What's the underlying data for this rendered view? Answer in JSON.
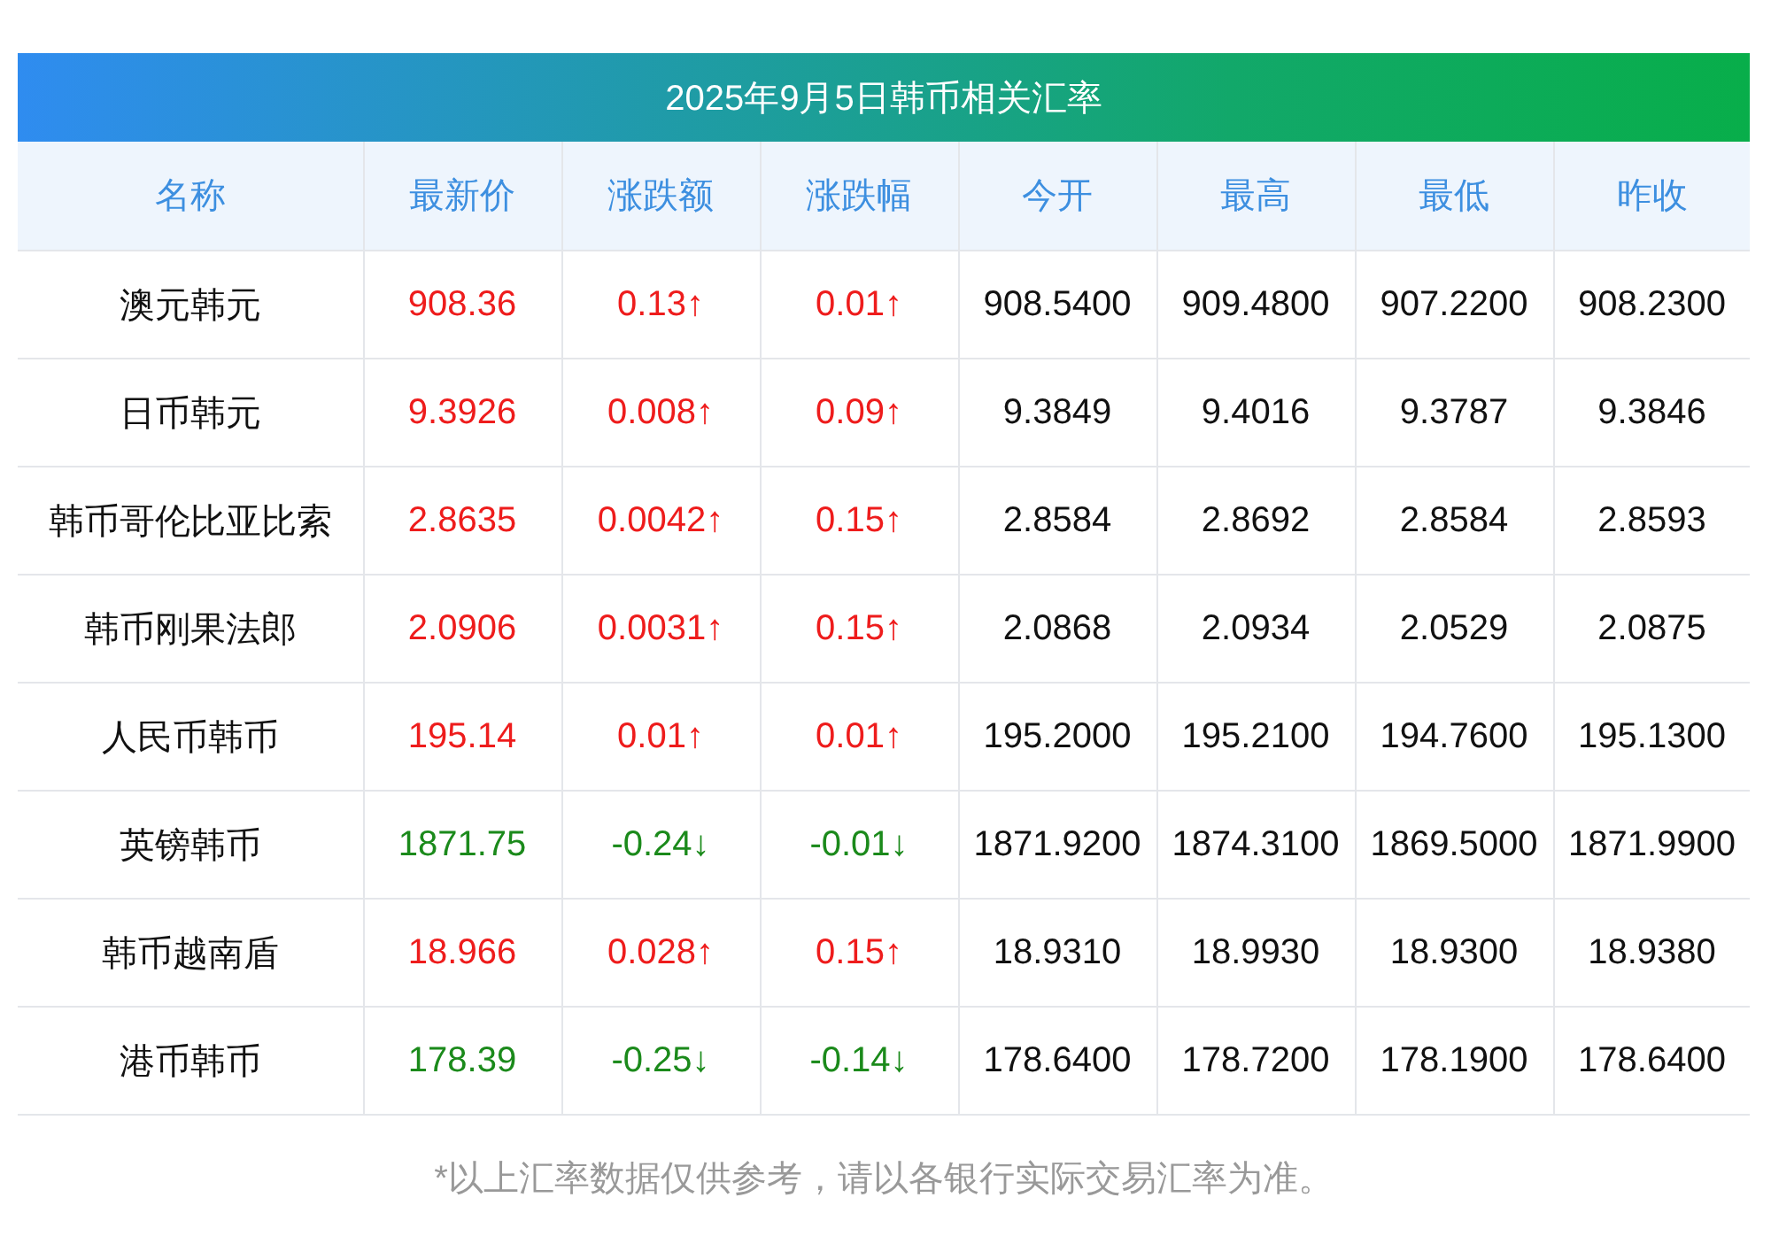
{
  "title": "2025年9月5日韩币相关汇率",
  "table": {
    "columns": [
      "名称",
      "最新价",
      "涨跌额",
      "涨跌幅",
      "今开",
      "最高",
      "最低",
      "昨收"
    ],
    "rows": [
      {
        "kind": "up",
        "cells": [
          "澳元韩元",
          "908.36",
          "0.13↑",
          "0.01↑",
          "908.5400",
          "909.4800",
          "907.2200",
          "908.2300"
        ]
      },
      {
        "kind": "up",
        "cells": [
          "日币韩元",
          "9.3926",
          "0.008↑",
          "0.09↑",
          "9.3849",
          "9.4016",
          "9.3787",
          "9.3846"
        ]
      },
      {
        "kind": "up",
        "cells": [
          "韩币哥伦比亚比索",
          "2.8635",
          "0.0042↑",
          "0.15↑",
          "2.8584",
          "2.8692",
          "2.8584",
          "2.8593"
        ]
      },
      {
        "kind": "up",
        "cells": [
          "韩币刚果法郎",
          "2.0906",
          "0.0031↑",
          "0.15↑",
          "2.0868",
          "2.0934",
          "2.0529",
          "2.0875"
        ]
      },
      {
        "kind": "up",
        "cells": [
          "人民币韩币",
          "195.14",
          "0.01↑",
          "0.01↑",
          "195.2000",
          "195.2100",
          "194.7600",
          "195.1300"
        ]
      },
      {
        "kind": "down",
        "cells": [
          "英镑韩币",
          "1871.75",
          "-0.24↓",
          "-0.01↓",
          "1871.9200",
          "1874.3100",
          "1869.5000",
          "1871.9900"
        ]
      },
      {
        "kind": "up",
        "cells": [
          "韩币越南盾",
          "18.966",
          "0.028↑",
          "0.15↑",
          "18.9310",
          "18.9930",
          "18.9300",
          "18.9380"
        ]
      },
      {
        "kind": "down",
        "cells": [
          "港币韩币",
          "178.39",
          "-0.25↓",
          "-0.14↓",
          "178.6400",
          "178.7200",
          "178.1900",
          "178.6400"
        ]
      }
    ]
  },
  "footnote": "*以上汇率数据仅供参考，请以各银行实际交易汇率为准。"
}
